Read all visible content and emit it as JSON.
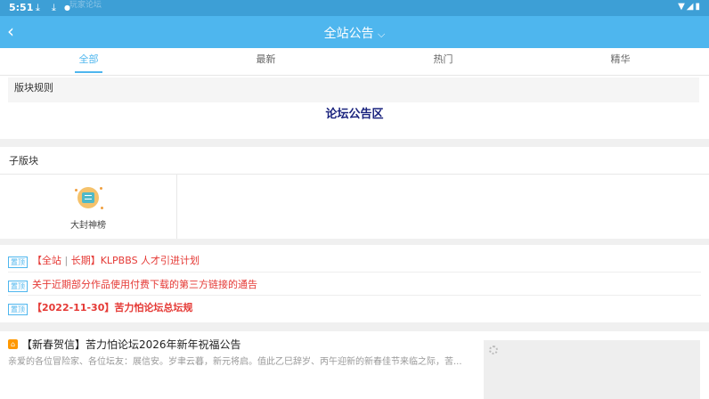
{
  "status_bar": {
    "time": "5:51",
    "ghost_text": "玩家论坛",
    "right_icons": [
      "wifi-icon",
      "signal-icon",
      "battery-icon"
    ]
  },
  "app_bar": {
    "title": "全站公告",
    "title_suffix": "⌵",
    "accent": "#4eb6ee"
  },
  "tabs": [
    {
      "label": "全部",
      "active": true
    },
    {
      "label": "最新",
      "active": false
    },
    {
      "label": "热门",
      "active": false
    },
    {
      "label": "精华",
      "active": false
    }
  ],
  "rules": {
    "header": "版块规则",
    "body": "论坛公告区"
  },
  "subforums": {
    "header": "子版块",
    "items": [
      {
        "label": "大封神榜",
        "icon": "ranking-icon"
      }
    ]
  },
  "sticky": [
    {
      "tag": "置顶",
      "prefix": "【全站",
      "mid": "长期】",
      "title": "KLPBBS 人才引进计划",
      "bold": false
    },
    {
      "tag": "置顶",
      "text": "关于近期部分作品使用付费下载的第三方链接的通告",
      "bold": false
    },
    {
      "tag": "置顶",
      "text": "【2022-11-30】苦力怕论坛总坛规",
      "bold": true
    }
  ],
  "feed": [
    {
      "badge": "⌂",
      "title": "【新春贺信】苦力怕论坛2026年新年祝福公告",
      "excerpt": "亲爱的各位冒险家、各位坛友：展信安。岁聿云暮，新元将启。值此乙巳辞岁、丙午迎新的新春佳节来临之际，苦...",
      "has_image": true
    }
  ]
}
